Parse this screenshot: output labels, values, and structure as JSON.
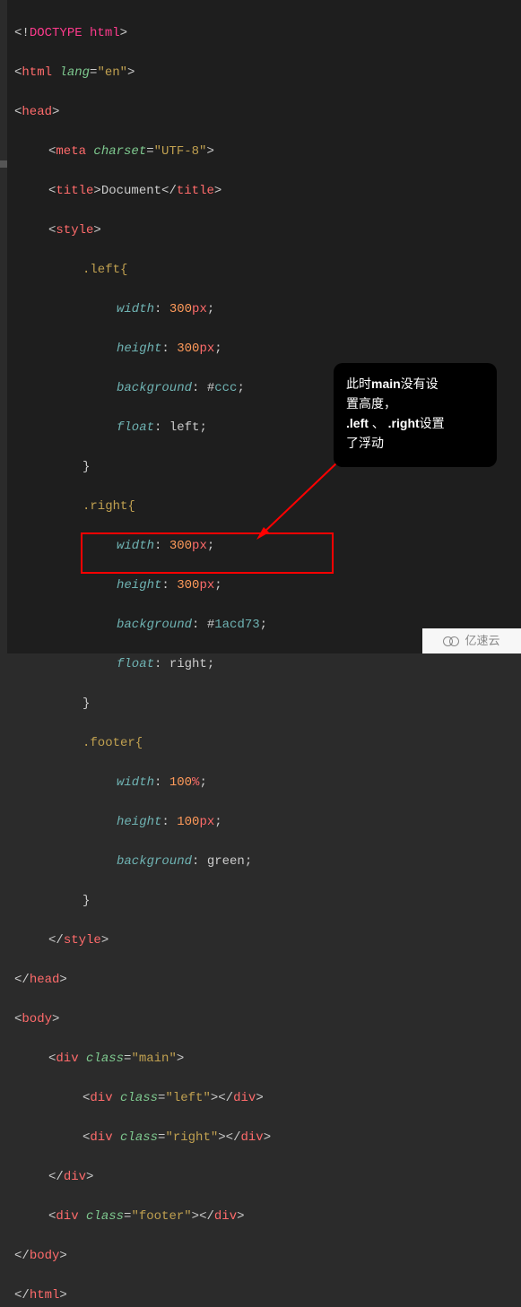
{
  "code": {
    "l1_a": "<!",
    "l1_b": "DOCTYPE html",
    "l1_c": ">",
    "l2_a": "<",
    "l2_b": "html",
    "l2_c": " ",
    "l2_d": "lang",
    "l2_e": "=",
    "l2_f": "\"en\"",
    "l2_g": ">",
    "l3_a": "<",
    "l3_b": "head",
    "l3_c": ">",
    "l4_a": "<",
    "l4_b": "meta",
    "l4_c": " ",
    "l4_d": "charset",
    "l4_e": "=",
    "l4_f": "\"UTF-8\"",
    "l4_g": ">",
    "l5_a": "<",
    "l5_b": "title",
    "l5_c": ">",
    "l5_d": "Document",
    "l5_e": "</",
    "l5_f": "title",
    "l5_g": ">",
    "l6_a": "<",
    "l6_b": "style",
    "l6_c": ">",
    "l7": ".left{",
    "l8_a": "width",
    "l8_b": ": ",
    "l8_c": "300",
    "l8_d": "px",
    "l8_e": ";",
    "l9_a": "height",
    "l9_b": ": ",
    "l9_c": "300",
    "l9_d": "px",
    "l9_e": ";",
    "l10_a": "background",
    "l10_b": ": ",
    "l10_c": "#",
    "l10_d": "ccc",
    "l10_e": ";",
    "l11_a": "float",
    "l11_b": ": ",
    "l11_c": "left",
    "l11_d": ";",
    "l12": "}",
    "l13": ".right{",
    "l14_a": "width",
    "l14_b": ": ",
    "l14_c": "300",
    "l14_d": "px",
    "l14_e": ";",
    "l15_a": "height",
    "l15_b": ": ",
    "l15_c": "300",
    "l15_d": "px",
    "l15_e": ";",
    "l16_a": "background",
    "l16_b": ": ",
    "l16_c": "#",
    "l16_d": "1acd73",
    "l16_e": ";",
    "l17_a": "float",
    "l17_b": ": ",
    "l17_c": "right",
    "l17_d": ";",
    "l18": "}",
    "l19": ".footer{",
    "l20_a": "width",
    "l20_b": ": ",
    "l20_c": "100",
    "l20_d": "%",
    "l20_e": ";",
    "l21_a": "height",
    "l21_b": ": ",
    "l21_c": "100",
    "l21_d": "px",
    "l21_e": ";",
    "l22_a": "background",
    "l22_b": ": ",
    "l22_c": "green",
    "l22_d": ";",
    "l23": "}",
    "l24_a": "</",
    "l24_b": "style",
    "l24_c": ">",
    "l25_a": "</",
    "l25_b": "head",
    "l25_c": ">",
    "l26_a": "<",
    "l26_b": "body",
    "l26_c": ">",
    "l27_a": "<",
    "l27_b": "div",
    "l27_c": " ",
    "l27_d": "class",
    "l27_e": "=",
    "l27_f": "\"main\"",
    "l27_g": ">",
    "l28_a": "<",
    "l28_b": "div",
    "l28_c": " ",
    "l28_d": "class",
    "l28_e": "=",
    "l28_f": "\"left\"",
    "l28_g": "></",
    "l28_h": "div",
    "l28_i": ">",
    "l29_a": "<",
    "l29_b": "div",
    "l29_c": " ",
    "l29_d": "class",
    "l29_e": "=",
    "l29_f": "\"right\"",
    "l29_g": "></",
    "l29_h": "div",
    "l29_i": ">",
    "l30_a": "</",
    "l30_b": "div",
    "l30_c": ">",
    "l31_a": "<",
    "l31_b": "div",
    "l31_c": " ",
    "l31_d": "class",
    "l31_e": "=",
    "l31_f": "\"footer\"",
    "l31_g": "></",
    "l31_h": "div",
    "l31_i": ">",
    "l32_a": "</",
    "l32_b": "body",
    "l32_c": ">",
    "l33_a": "</",
    "l33_b": "html",
    "l33_c": ">"
  },
  "tooltip": {
    "t1_a": "此时",
    "t1_b": "main",
    "t1_c": "没有设",
    "t2": "置高度，",
    "t3_a": ".left",
    "t3_b": " 、 ",
    "t3_c": ".right",
    "t3_d": "设置",
    "t4": "了浮动"
  },
  "watermark": {
    "text": "亿速云"
  }
}
